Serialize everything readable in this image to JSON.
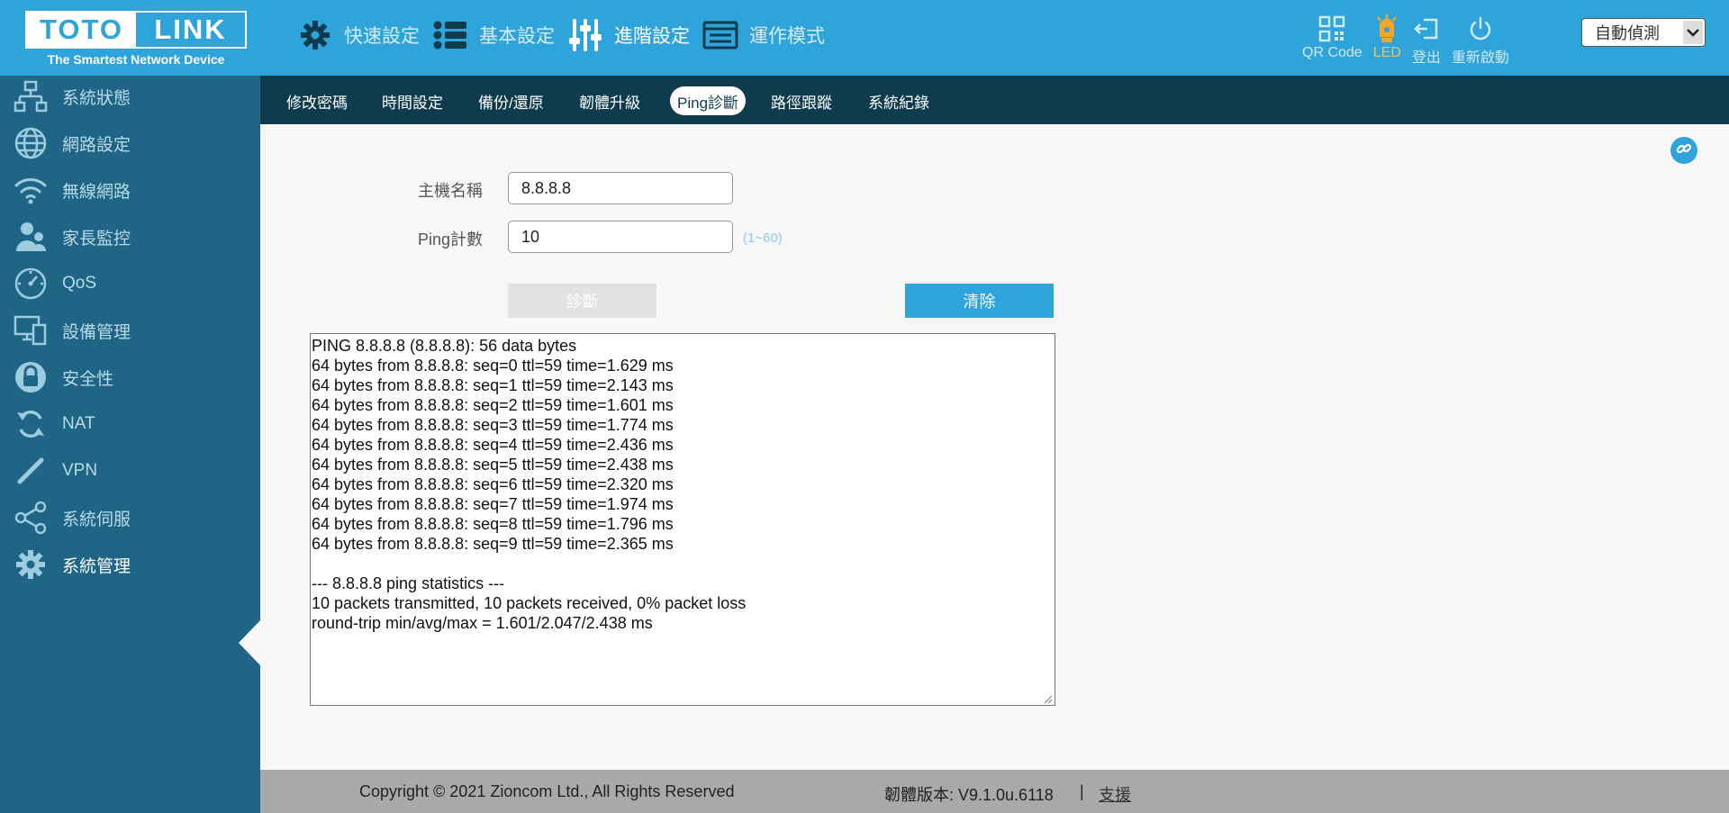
{
  "logo": {
    "left": "TOTO",
    "right": "LINK",
    "tagline": "The Smartest Network Device"
  },
  "topnav": [
    {
      "label": "快速設定",
      "icon": "gear-icon"
    },
    {
      "label": "基本設定",
      "icon": "list-icon"
    },
    {
      "label": "進階設定",
      "icon": "sliders-icon",
      "active": true
    },
    {
      "label": "運作模式",
      "icon": "mode-icon"
    }
  ],
  "tools": {
    "qr": "QR Code",
    "led": "LED",
    "logout": "登出",
    "reboot": "重新啟動"
  },
  "language": {
    "selected": "自動偵測"
  },
  "sidebar": {
    "items": [
      {
        "label": "系統狀態",
        "icon": "network-status-icon"
      },
      {
        "label": "網路設定",
        "icon": "globe-icon"
      },
      {
        "label": "無線網路",
        "icon": "wifi-icon"
      },
      {
        "label": "家長監控",
        "icon": "parental-control-icon"
      },
      {
        "label": "QoS",
        "icon": "speedometer-icon"
      },
      {
        "label": "設備管理",
        "icon": "devices-icon"
      },
      {
        "label": "安全性",
        "icon": "lock-icon"
      },
      {
        "label": "NAT",
        "icon": "refresh-icon"
      },
      {
        "label": "VPN",
        "icon": "link-chain-icon"
      },
      {
        "label": "系統伺服",
        "icon": "share-icon"
      },
      {
        "label": "系統管理",
        "icon": "cog-icon",
        "active": true
      }
    ]
  },
  "subnav": {
    "tabs": [
      {
        "label": "修改密碼"
      },
      {
        "label": "時間設定"
      },
      {
        "label": "備份/還原"
      },
      {
        "label": "韌體升級"
      },
      {
        "label": "Ping診斷",
        "active": true
      },
      {
        "label": "路徑跟蹤"
      },
      {
        "label": "系統紀錄"
      }
    ]
  },
  "form": {
    "host_label": "主機名稱",
    "host_value": "8.8.8.8",
    "count_label": "Ping計數",
    "count_value": "10",
    "count_hint": "(1~60)",
    "diagnose_button": "診斷",
    "clear_button": "清除"
  },
  "output": {
    "lines": [
      "PING 8.8.8.8 (8.8.8.8): 56 data bytes",
      "64 bytes from 8.8.8.8: seq=0 ttl=59 time=1.629 ms",
      "64 bytes from 8.8.8.8: seq=1 ttl=59 time=2.143 ms",
      "64 bytes from 8.8.8.8: seq=2 ttl=59 time=1.601 ms",
      "64 bytes from 8.8.8.8: seq=3 ttl=59 time=1.774 ms",
      "64 bytes from 8.8.8.8: seq=4 ttl=59 time=2.436 ms",
      "64 bytes from 8.8.8.8: seq=5 ttl=59 time=2.438 ms",
      "64 bytes from 8.8.8.8: seq=6 ttl=59 time=2.320 ms",
      "64 bytes from 8.8.8.8: seq=7 ttl=59 time=1.974 ms",
      "64 bytes from 8.8.8.8: seq=8 ttl=59 time=1.796 ms",
      "64 bytes from 8.8.8.8: seq=9 ttl=59 time=2.365 ms",
      "",
      "--- 8.8.8.8 ping statistics ---",
      "10 packets transmitted, 10 packets received, 0% packet loss",
      "round-trip min/avg/max = 1.601/2.047/2.438 ms"
    ]
  },
  "footer": {
    "copyright": "Copyright © 2021 Zioncom Ltd., All Rights Reserved",
    "firmware": "韌體版本: V9.1.0u.6118",
    "separator": "|",
    "support": "支援"
  },
  "colors": {
    "header": "#2ea4db",
    "sidebar": "#1f6586",
    "subnav": "#0f3b4f",
    "accent": "#2ea4db",
    "led": "#f5a623"
  }
}
